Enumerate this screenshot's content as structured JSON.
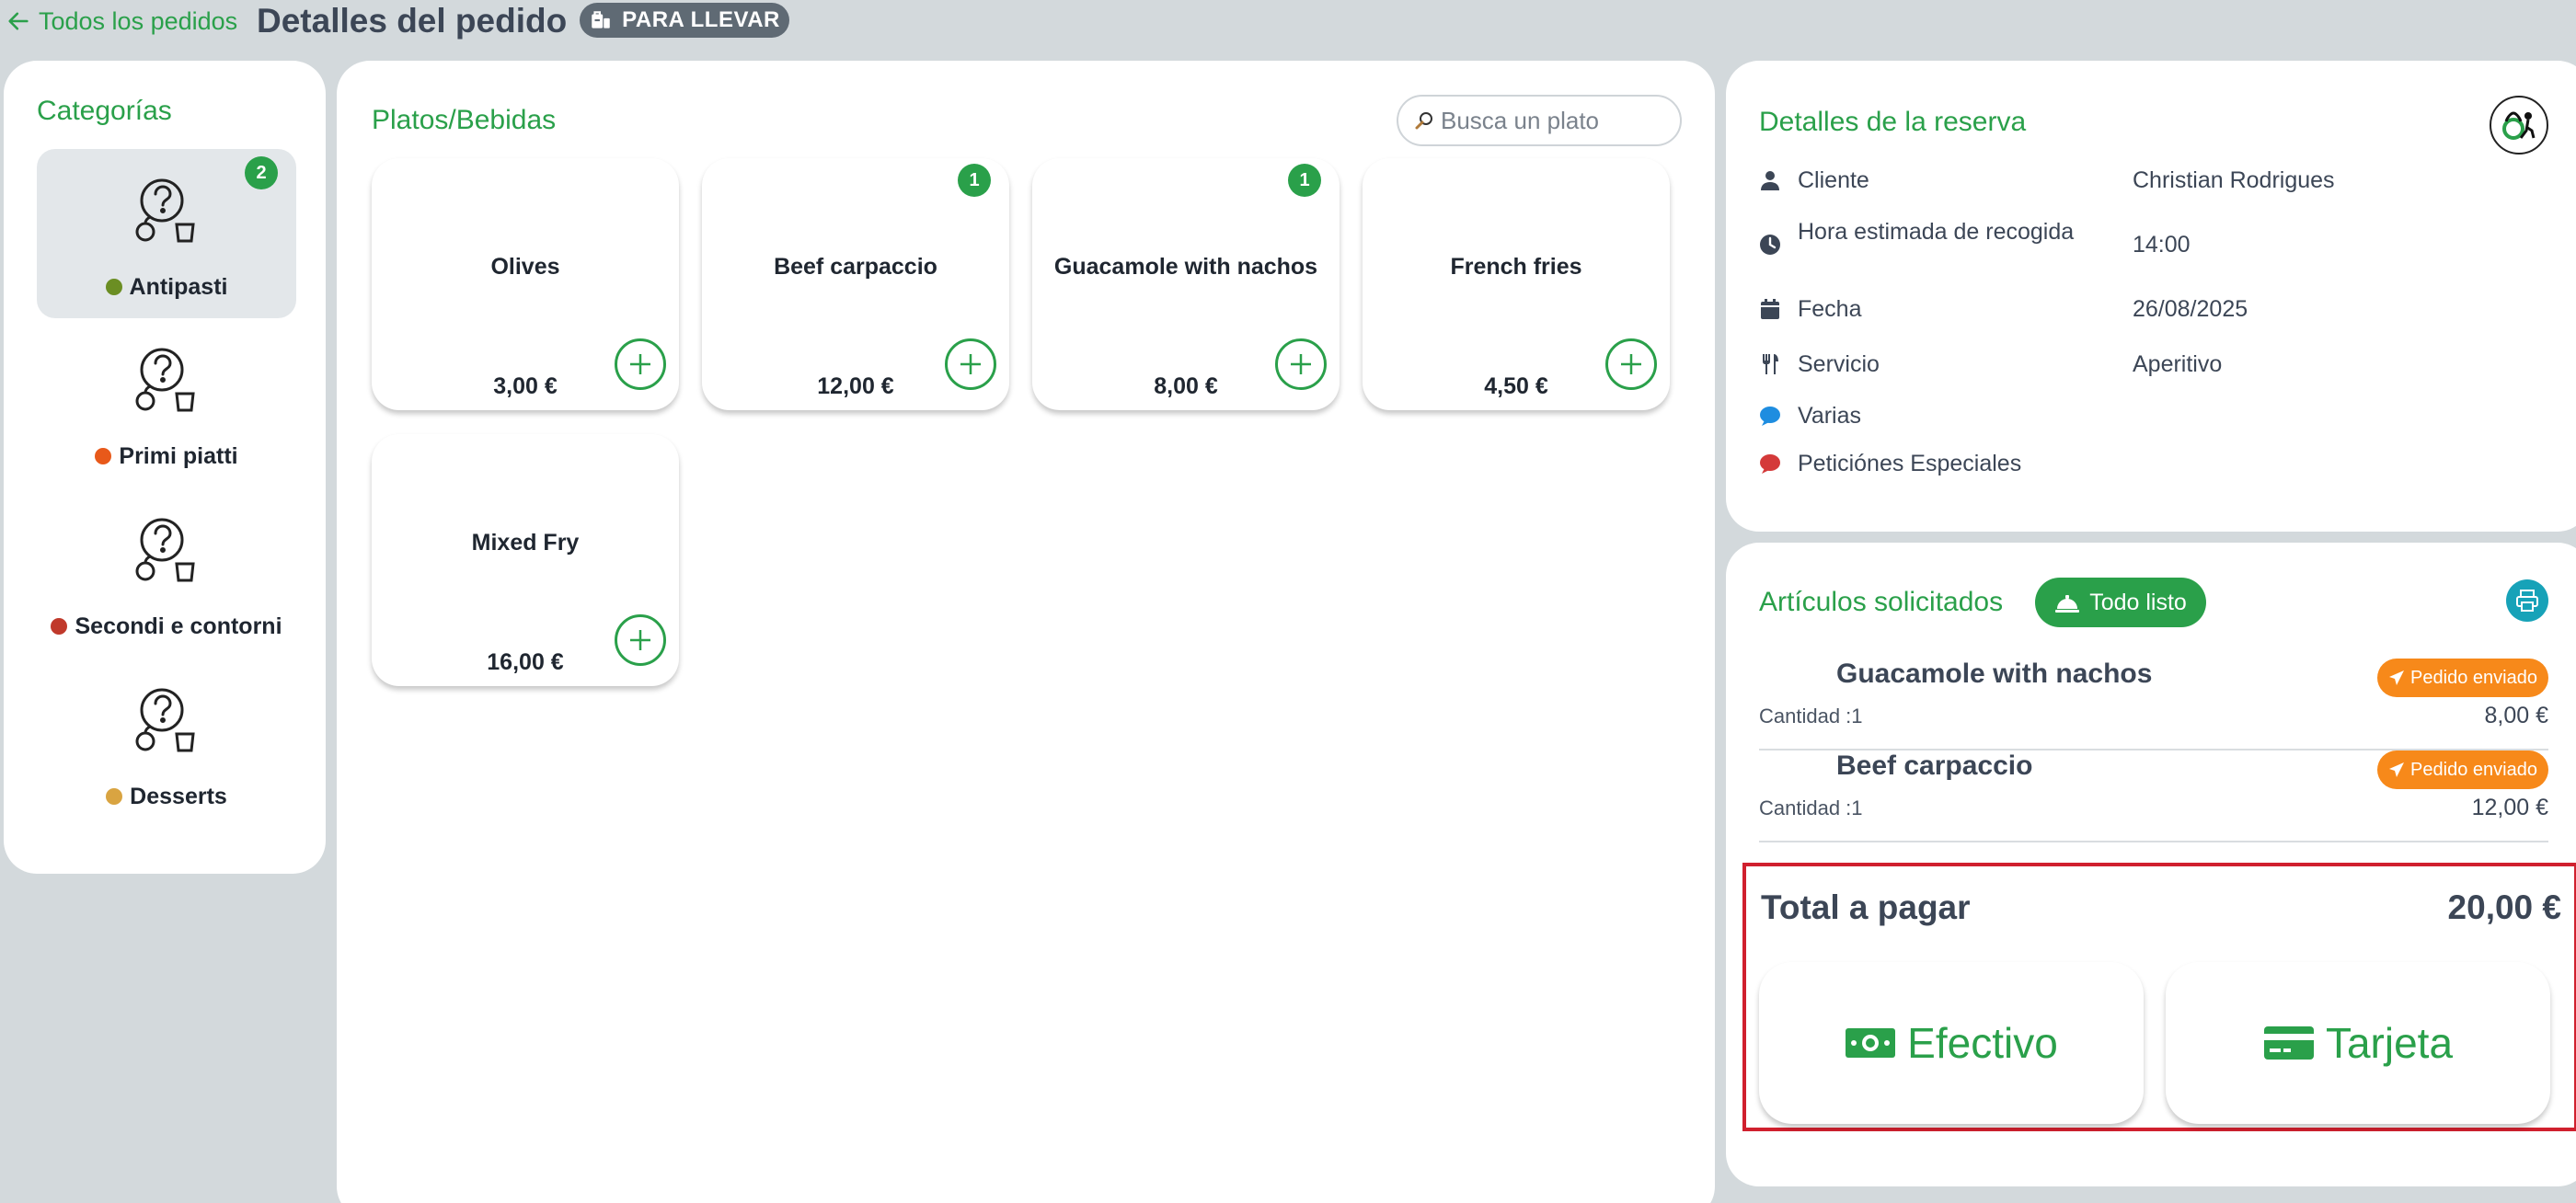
{
  "header": {
    "back_label": "Todos los pedidos",
    "title": "Detalles del pedido",
    "order_type_badge": "PARA LLEVAR"
  },
  "categories": {
    "title": "Categorías",
    "items": [
      {
        "label": "Antipasti",
        "emoji_color": "#6b8e23",
        "badge": "2",
        "active": true
      },
      {
        "label": "Primi piatti",
        "emoji_color": "#e8591a",
        "badge": "",
        "active": false
      },
      {
        "label": "Secondi e contorni",
        "emoji_color": "#c0392b",
        "badge": "",
        "active": false
      },
      {
        "label": "Desserts",
        "emoji_color": "#d9a441",
        "badge": "",
        "active": false
      }
    ]
  },
  "dishes": {
    "title": "Platos/Bebidas",
    "search_placeholder": "Busca un plato",
    "items": [
      {
        "name": "Olives",
        "price": "3,00 €",
        "badge": ""
      },
      {
        "name": "Beef carpaccio",
        "price": "12,00 €",
        "badge": "1"
      },
      {
        "name": "Guacamole with nachos",
        "price": "8,00 €",
        "badge": "1"
      },
      {
        "name": "French fries",
        "price": "4,50 €",
        "badge": ""
      },
      {
        "name": "Mixed Fry",
        "price": "16,00 €",
        "badge": ""
      }
    ]
  },
  "reservation": {
    "title": "Detalles de la reserva",
    "rows": [
      {
        "icon": "person-icon",
        "label": "Cliente",
        "value": "Christian Rodrigues"
      },
      {
        "icon": "clock-icon",
        "label": "Hora estimada de recogida",
        "value": "14:00"
      },
      {
        "icon": "calendar-icon",
        "label": "Fecha",
        "value": "26/08/2025"
      },
      {
        "icon": "utensils-icon",
        "label": "Servicio",
        "value": "Aperitivo"
      },
      {
        "icon": "chat-bubble-icon",
        "label": "Varias",
        "value": ""
      },
      {
        "icon": "chat-bubble-icon",
        "label": "Peticiónes Especiales",
        "value": ""
      }
    ]
  },
  "ordered_items": {
    "title": "Artículos solicitados",
    "all_ready_label": "Todo listo",
    "items": [
      {
        "name": "Guacamole with nachos",
        "qty": "Cantidad :1",
        "price": "8,00 €",
        "status": "Pedido enviado"
      },
      {
        "name": "Beef carpaccio",
        "qty": "Cantidad :1",
        "price": "12,00 €",
        "status": "Pedido enviado"
      }
    ]
  },
  "payment": {
    "total_label": "Total a pagar",
    "total_value": "20,00 €",
    "cash_label": "Efectivo",
    "card_label": "Tarjeta"
  },
  "colors": {
    "accent": "#2aa04a",
    "status_orange": "#f7891a",
    "print_teal": "#17a2b8",
    "highlight_red": "#d0202e"
  }
}
